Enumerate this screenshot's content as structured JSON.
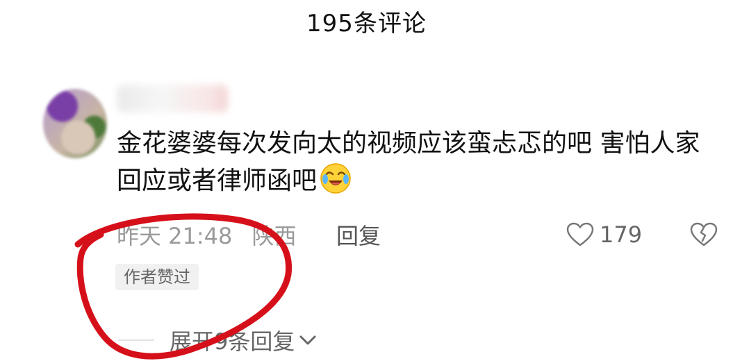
{
  "header": {
    "title": "195条评论"
  },
  "comment": {
    "text": "金花婆婆每次发向太的视频应该蛮忐忑的吧 害怕人家回应或者律师函吧",
    "time": "昨天 21:48",
    "location": "陕西",
    "reply_label": "回复",
    "like_count": "179",
    "author_liked_label": "作者赞过",
    "expand_replies_label": "展开9条回复",
    "emoji": "crying-laughing-emoji",
    "annotation_color": "#d6101a"
  }
}
